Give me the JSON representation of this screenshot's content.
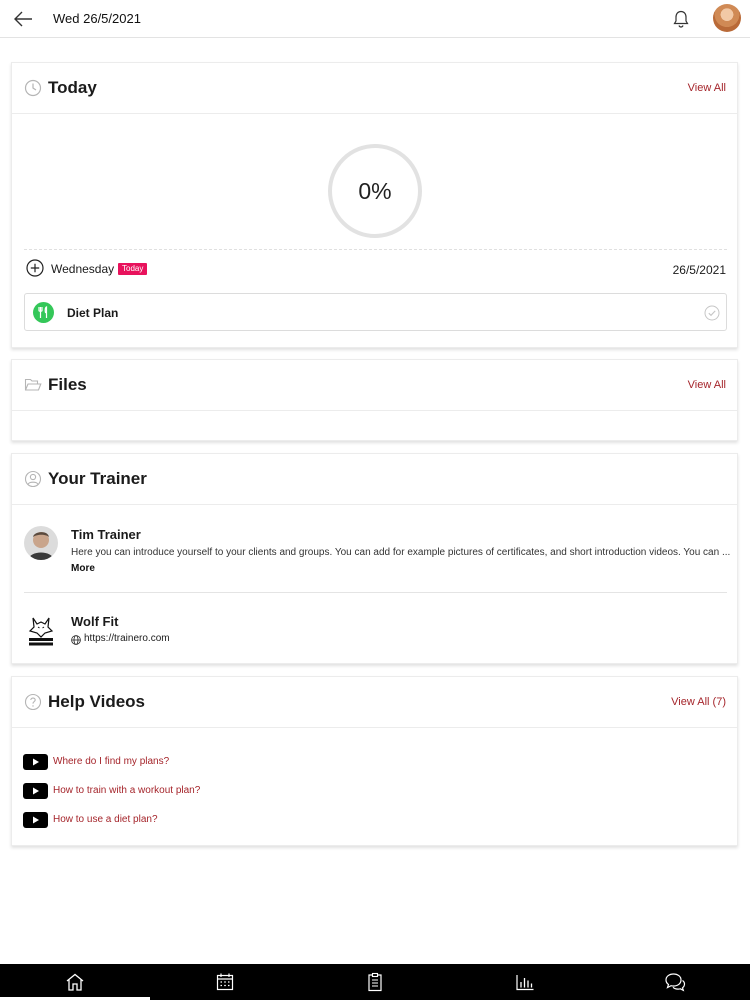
{
  "header": {
    "date_title": "Wed 26/5/2021",
    "back_icon": "arrow-left-icon",
    "bell_icon": "bell-icon"
  },
  "today": {
    "title": "Today",
    "view_all": "View All",
    "progress_percent": 0,
    "progress_text": "0%",
    "day_name": "Wednesday",
    "badge": "Today",
    "date": "26/5/2021",
    "plan": {
      "name": "Diet Plan",
      "completed": false
    }
  },
  "files": {
    "title": "Files",
    "view_all": "View All"
  },
  "trainer": {
    "title": "Your Trainer",
    "name": "Tim Trainer",
    "bio": "Here you can introduce yourself to your clients and groups. You can add for example pictures of certificates, and short introduction videos. You can ...",
    "more": "More",
    "brand_name": "Wolf Fit",
    "brand_url": "https://trainero.com"
  },
  "help": {
    "title": "Help Videos",
    "view_all": "View All (7)",
    "videos": [
      "Where do I find my plans?",
      "How to train with a workout plan?",
      "How to use a diet plan?"
    ]
  },
  "bottom_nav": {
    "items": [
      "home-icon",
      "calendar-icon",
      "clipboard-icon",
      "stats-icon",
      "chat-icon"
    ],
    "active": "home-icon"
  },
  "colors": {
    "accent_link": "#a5252b",
    "badge": "#e8125c",
    "diet_icon": "#34c759",
    "nav_bg": "#000000"
  }
}
